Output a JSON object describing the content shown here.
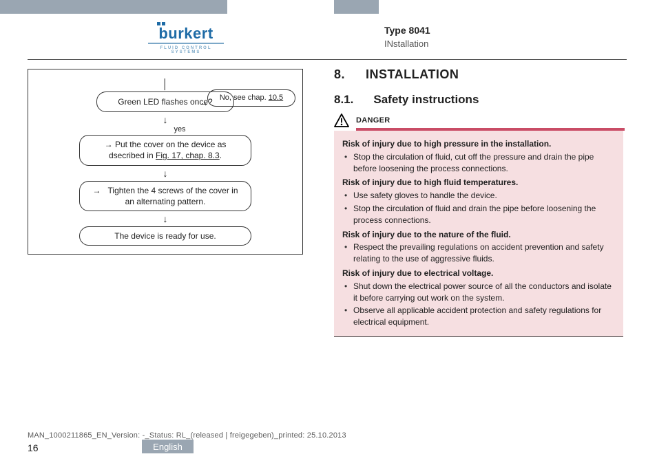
{
  "logo": {
    "wordmark": "burkert",
    "tagline": "FLUID CONTROL SYSTEMS"
  },
  "header": {
    "type_line": "Type 8041",
    "section_line": "INstallation"
  },
  "flow": {
    "led_q": "Green LED flashes once?",
    "no_box_pre": "No, see chap. ",
    "no_box_link": "10.5",
    "yes": "yes",
    "cover_pre": "Put the cover on the device as dsecribed in ",
    "cover_link": "Fig. 17, chap. 8.3",
    "cover_post": ".",
    "tighten": "Tighten the 4 screws of the cover in an alternating pattern.",
    "ready": "The device is ready for use."
  },
  "main": {
    "sec_num": "8.",
    "sec_title": "INSTALLATION",
    "sub_num": "8.1.",
    "sub_title": "Safety instructions",
    "danger_label": "DANGER",
    "risk1_h": "Risk of injury due to high pressure in the installation.",
    "risk1_b1": "Stop the circulation of fluid, cut off the pressure and drain the pipe before loosening the process connections.",
    "risk2_h": "Risk of injury due to high fluid temperatures.",
    "risk2_b1": "Use safety gloves to handle the device.",
    "risk2_b2": "Stop the circulation of fluid and drain the pipe before loosening the process connections.",
    "risk3_h": "Risk of injury due to the nature of the fluid.",
    "risk3_b1": "Respect the prevailing regulations on accident prevention and safety relating to the use of aggressive fluids.",
    "risk4_h": "Risk of injury due to electrical voltage.",
    "risk4_b1": "Shut down the electrical power source of all the conductors and isolate it before carrying out work on the system.",
    "risk4_b2": "Observe all applicable accident protection and safety regulations for electrical equipment."
  },
  "footer": {
    "page": "16",
    "lang": "English",
    "print_line": "MAN_1000211865_EN_Version: -_Status: RL_(released | freigegeben)_printed: 25.10.2013"
  }
}
